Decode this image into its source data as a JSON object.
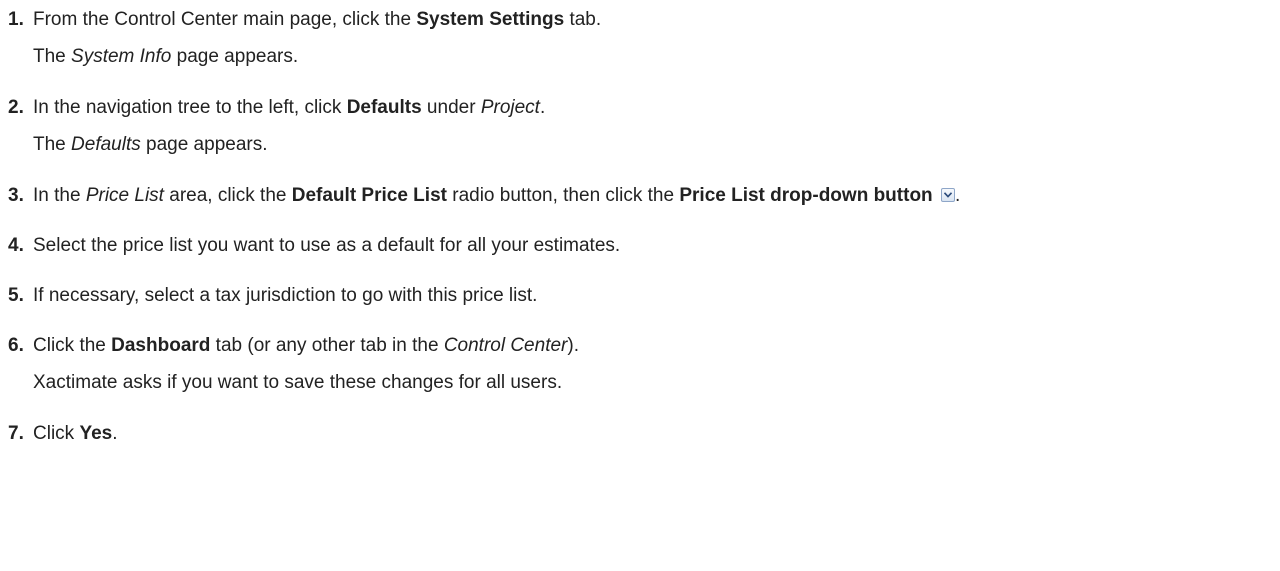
{
  "steps": [
    {
      "num": "1.",
      "parts": [
        "From the Control Center main page, click the ",
        "System Settings",
        " tab."
      ],
      "note": [
        "The ",
        "System Info",
        " page appears."
      ]
    },
    {
      "num": "2.",
      "parts": [
        "In the navigation tree to the left, click ",
        "Defaults",
        " under ",
        "Project",
        "."
      ],
      "note": [
        "The ",
        "Defaults",
        " page appears."
      ]
    },
    {
      "num": "3.",
      "parts": [
        "In the ",
        "Price List",
        " area, click the ",
        "Default Price List",
        " radio button, then click the ",
        "Price List drop-down button",
        "."
      ]
    },
    {
      "num": "4.",
      "text": "Select the price list you want to use as a default for all your estimates."
    },
    {
      "num": "5.",
      "text": "If necessary, select a tax jurisdiction to go with this price list."
    },
    {
      "num": "6.",
      "parts": [
        "Click the ",
        "Dashboard",
        " tab (or any other tab in the ",
        "Control Center",
        ")."
      ],
      "note": "Xactimate asks if you want to save these changes for all users."
    },
    {
      "num": "7.",
      "parts": [
        "Click ",
        "Yes",
        "."
      ]
    }
  ],
  "icons": {
    "dropdown_button": "chevron-down-icon"
  }
}
